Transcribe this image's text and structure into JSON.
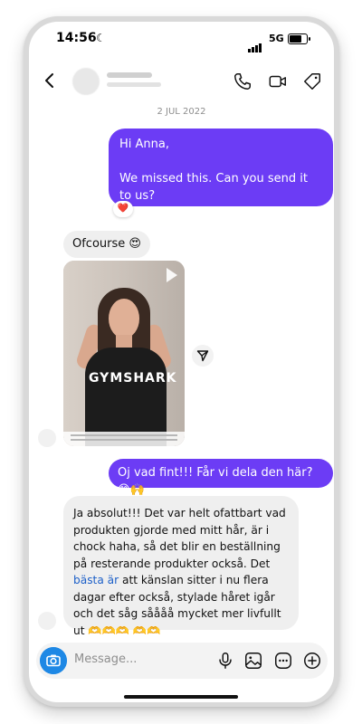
{
  "status_bar": {
    "time": "14:56",
    "network": "5G"
  },
  "header": {
    "title_hidden": true
  },
  "date_separator": "2 JUL 2022",
  "messages": [
    {
      "direction": "outgoing",
      "lines": [
        "Hi Anna,",
        "",
        "We missed this. Can you send it to us?",
        "😊"
      ],
      "reaction": "❤️"
    },
    {
      "direction": "incoming",
      "text": "Ofcourse 😍"
    },
    {
      "direction": "incoming",
      "type": "video",
      "shirt_text": "GYMSHARK"
    },
    {
      "direction": "outgoing",
      "text": "Oj vad fint!!! Får vi dela den här? 😊🙌"
    },
    {
      "direction": "incoming",
      "text_before_link": "Ja absolut!!! Det var helt ofattbart vad produkten gjorde med mitt hår, är i chock haha, så det blir en beställning på resterande produkter också. Det ",
      "link_text": "bästa är",
      "text_after_link": " att känslan sitter i nu flera dagar efter också, stylade håret igår och det såg såååå mycket mer livfullt ut 🫶🫶🫶 🫶🫶"
    }
  ],
  "composer": {
    "placeholder": "Message..."
  },
  "colors": {
    "outgoing_bubble": "#6c3cf5",
    "incoming_bubble": "#efefef",
    "link": "#1c5fc8",
    "camera_button": "#1e88e5"
  },
  "icons": {
    "back": "chevron-left-icon",
    "call": "phone-icon",
    "video": "video-camera-icon",
    "tag": "tag-icon",
    "share": "send-icon",
    "camera": "camera-icon",
    "mic": "microphone-icon",
    "gallery": "image-icon",
    "sticker": "sticker-icon",
    "add": "plus-icon"
  }
}
